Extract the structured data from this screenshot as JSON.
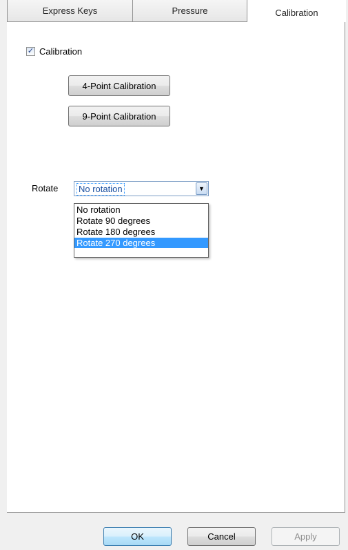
{
  "tabs": [
    {
      "label": "Express Keys",
      "active": false
    },
    {
      "label": "Pressure",
      "active": false
    },
    {
      "label": "Calibration",
      "active": true
    }
  ],
  "calibration": {
    "checkbox_label": "Calibration",
    "checked": true,
    "button_4pt": "4-Point Calibration",
    "button_9pt": "9-Point Calibration"
  },
  "rotate": {
    "label": "Rotate",
    "selected": "No rotation",
    "options": [
      "No rotation",
      "Rotate 90 degrees",
      "Rotate 180 degrees",
      "Rotate 270 degrees"
    ],
    "highlighted": "Rotate 270 degrees"
  },
  "dialog_buttons": {
    "ok": "OK",
    "cancel": "Cancel",
    "apply": "Apply",
    "apply_enabled": false
  },
  "colors": {
    "highlight": "#3399ff",
    "panel": "#ffffff",
    "background": "#f0f0f0"
  }
}
